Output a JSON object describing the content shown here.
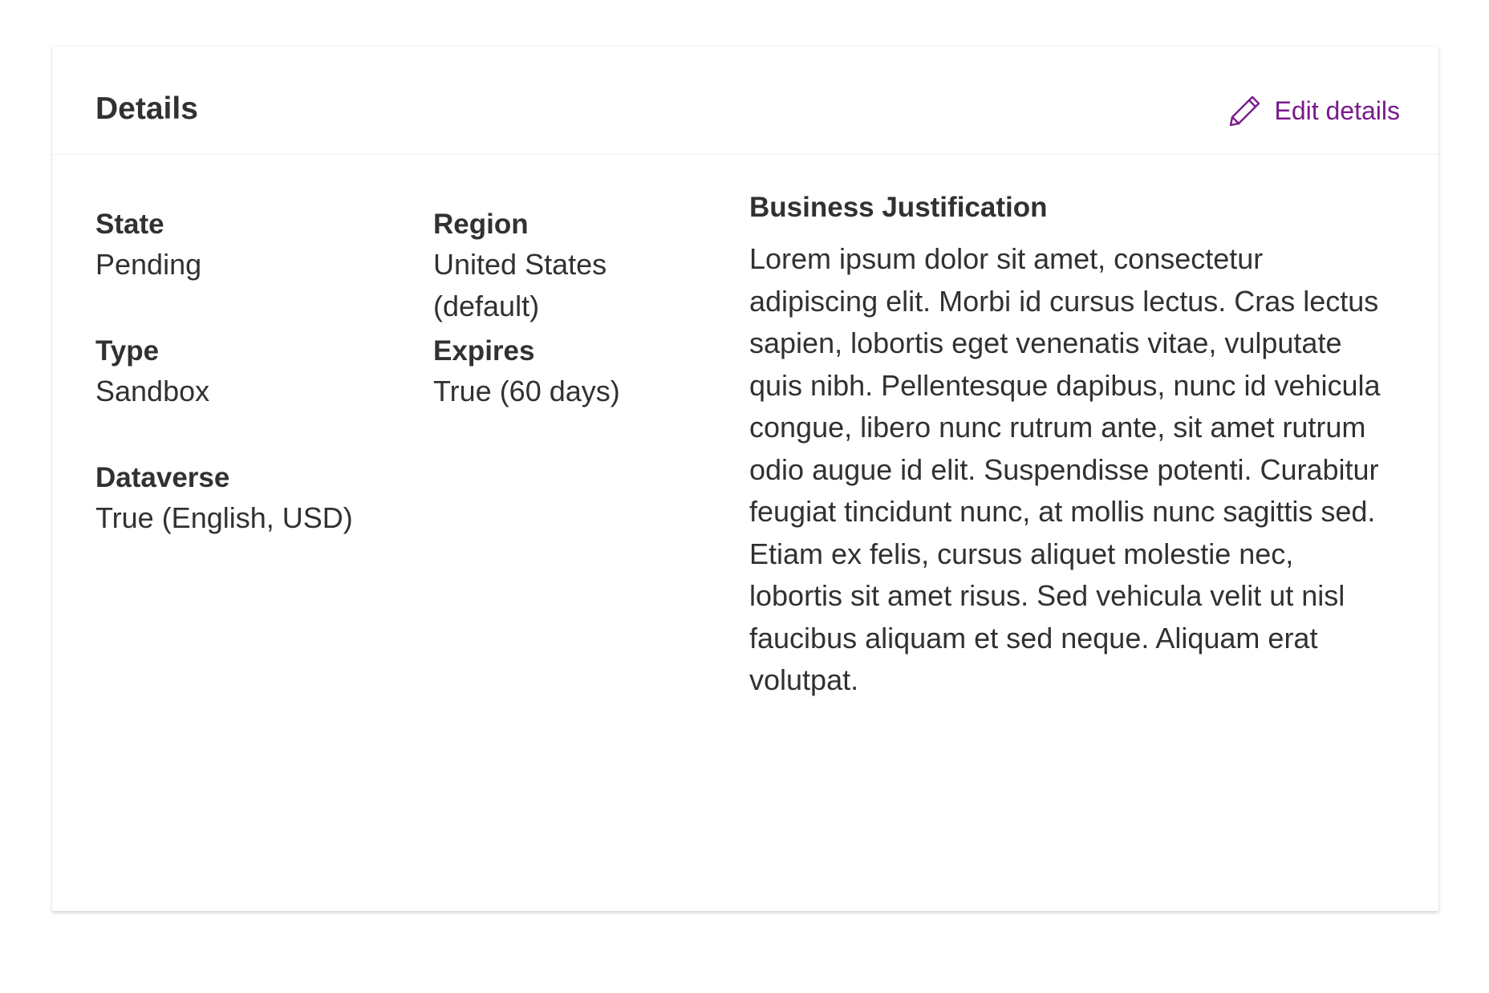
{
  "header": {
    "title": "Details",
    "edit_label": "Edit details",
    "edit_icon": "pencil-icon",
    "accent_color": "#7a1a8c"
  },
  "fields": {
    "state": {
      "label": "State",
      "value": "Pending"
    },
    "region": {
      "label": "Region",
      "value": "United States (default)"
    },
    "type": {
      "label": "Type",
      "value": "Sandbox"
    },
    "expires": {
      "label": "Expires",
      "value": "True (60 days)"
    },
    "dataverse": {
      "label": "Dataverse",
      "value": "True (English, USD)"
    }
  },
  "justification": {
    "label": "Business Justification",
    "text": "Lorem ipsum dolor sit amet, consectetur adipiscing elit. Morbi id cursus lectus. Cras lectus sapien, lobortis eget venenatis vitae, vulputate quis nibh. Pellentesque dapibus, nunc id vehicula congue, libero nunc rutrum ante, sit amet rutrum odio augue id elit. Suspendisse potenti. Curabitur feugiat tincidunt nunc, at mollis nunc sagittis sed. Etiam ex felis, cursus aliquet molestie nec, lobortis sit amet risus. Sed vehicula velit ut nisl faucibus aliquam et sed neque. Aliquam erat volutpat."
  }
}
